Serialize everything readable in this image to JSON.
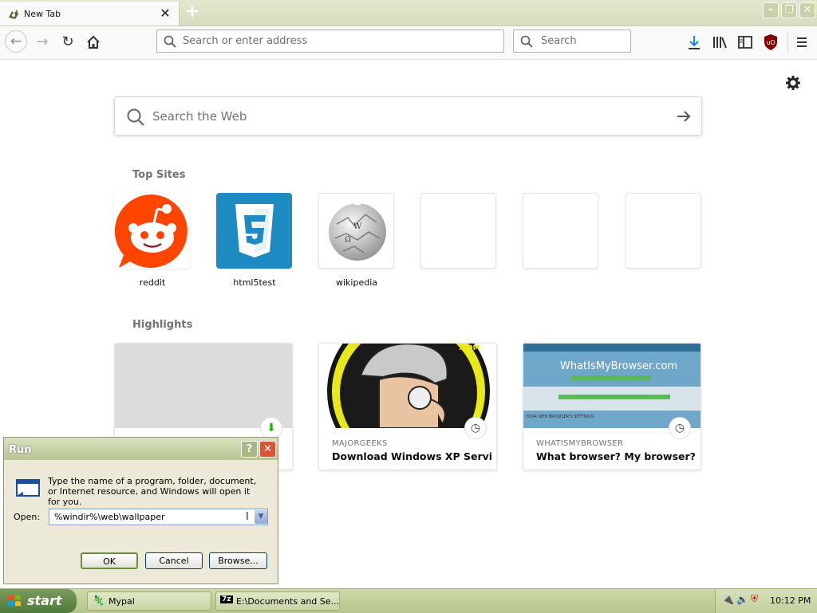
{
  "browser": {
    "tab_title": "New Tab",
    "url_placeholder": "Search or enter address",
    "search_placeholder": "Search"
  },
  "newtab": {
    "web_search_placeholder": "Search the Web",
    "top_sites_heading": "Top Sites",
    "top_sites": [
      {
        "label": "reddit",
        "icon": "reddit-icon"
      },
      {
        "label": "html5test",
        "icon": "html5-icon"
      },
      {
        "label": "wikipedia",
        "icon": "wikipedia-icon"
      },
      {
        "label": ""
      },
      {
        "label": ""
      },
      {
        "label": ""
      }
    ],
    "highlights_heading": "Highlights",
    "highlights": [
      {
        "source": "",
        "title": "",
        "badge": "download-icon"
      },
      {
        "source": "MAJORGEEKS",
        "title": "Download Windows XP Service ...",
        "badge": "clock-icon"
      },
      {
        "source": "WHATISMYBROWSER",
        "title": "What browser? My browser? Is...",
        "badge": "clock-icon",
        "thumb_heading": "WhatIsMyBrowser.com",
        "thumb_sub": "YOUR WEB BROWSER'S SETTINGS:"
      }
    ]
  },
  "run_dialog": {
    "title": "Run",
    "help_label": "?",
    "close_label": "✕",
    "description": "Type the name of a program, folder, document, or Internet resource, and Windows will open it for you.",
    "open_label": "Open:",
    "open_value": "%windir%\\web\\wallpaper",
    "ok_label": "OK",
    "cancel_label": "Cancel",
    "browse_label": "Browse..."
  },
  "taskbar": {
    "start_label": "start",
    "tasks": [
      {
        "label": "Mypal"
      },
      {
        "label": "E:\\Documents and Se..."
      }
    ],
    "clock": "10:12 PM"
  },
  "colors": {
    "accent": "#0a84ff",
    "xp_titlebar": "#b7c491",
    "taskbar": "#b6c48e",
    "start_button": "#4f7a3a"
  }
}
